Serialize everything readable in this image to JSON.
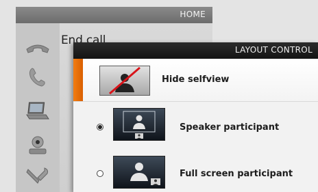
{
  "home": {
    "title": "HOME",
    "end_call_label": "End call",
    "icons": [
      "phone-hangup-icon",
      "phone-icon",
      "laptop-icon",
      "camera-icon",
      "wrench-icon"
    ]
  },
  "layout_control": {
    "title": "LAYOUT CONTROL",
    "hide_selfview_label": "Hide selfview",
    "options": [
      {
        "label": "Speaker participant",
        "selected": true
      },
      {
        "label": "Full screen participant",
        "selected": false
      }
    ]
  },
  "colors": {
    "accent_orange": "#ee7a10",
    "home_header": "#777777",
    "layout_header": "#1e1e1e"
  }
}
